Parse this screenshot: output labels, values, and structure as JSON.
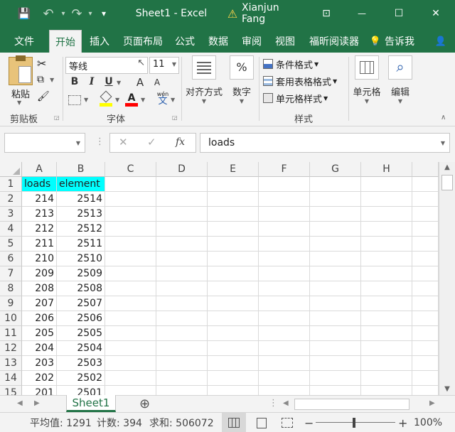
{
  "window": {
    "title": "Sheet1  -  Excel",
    "user": "Xianjun Fang",
    "save_icon": "💾",
    "undo_icon": "↶",
    "redo_icon": "↷",
    "qat_icon": "▾",
    "warning_icon": "⚠",
    "restore_ribbon_icon": "⊡",
    "minimize_icon": "—",
    "maximize_icon": "☐",
    "close_icon": "✕"
  },
  "menu": {
    "tabs": [
      {
        "label": "文件"
      },
      {
        "label": "开始"
      },
      {
        "label": "插入"
      },
      {
        "label": "页面布局"
      },
      {
        "label": "公式"
      },
      {
        "label": "数据"
      },
      {
        "label": "审阅"
      },
      {
        "label": "视图"
      },
      {
        "label": "福昕阅读器"
      }
    ],
    "tell_me": "告诉我",
    "lightbulb_icon": "💡",
    "share_icon": "👤"
  },
  "ribbon": {
    "clipboard": {
      "label": "剪贴板",
      "paste": "粘贴",
      "cut_icon": "✂",
      "copy_icon": "⧉",
      "format_painter_icon": "🖌"
    },
    "font": {
      "label": "字体",
      "font_name": "等线",
      "font_size": "11",
      "bold": "B",
      "italic": "I",
      "underline": "U",
      "grow_font": "A",
      "shrink_font": "A",
      "font_color_letter": "A",
      "phonetic": "wén",
      "phonetic_char": "文",
      "fill_color": "#ffff00",
      "font_color": "#ff0000"
    },
    "alignment": {
      "label": "对齐方式"
    },
    "number": {
      "label": "数字",
      "icon": "%"
    },
    "styles": {
      "label": "样式",
      "conditional": "条件格式",
      "table_format": "套用表格格式",
      "cell_styles": "单元格样式"
    },
    "cells": {
      "label": "单元格"
    },
    "editing": {
      "label": "编辑",
      "icon": "⌕"
    }
  },
  "formula_bar": {
    "name_box": "",
    "cancel_icon": "✕",
    "enter_icon": "✓",
    "fx_label": "fx",
    "content": "loads"
  },
  "sheet": {
    "columns": [
      "A",
      "B",
      "C",
      "D",
      "E",
      "F",
      "G",
      "H"
    ],
    "rows": [
      {
        "n": "1",
        "a": "loads",
        "b": "element"
      },
      {
        "n": "2",
        "a": "214",
        "b": "2514"
      },
      {
        "n": "3",
        "a": "213",
        "b": "2513"
      },
      {
        "n": "4",
        "a": "212",
        "b": "2512"
      },
      {
        "n": "5",
        "a": "211",
        "b": "2511"
      },
      {
        "n": "6",
        "a": "210",
        "b": "2510"
      },
      {
        "n": "7",
        "a": "209",
        "b": "2509"
      },
      {
        "n": "8",
        "a": "208",
        "b": "2508"
      },
      {
        "n": "9",
        "a": "207",
        "b": "2507"
      },
      {
        "n": "10",
        "a": "206",
        "b": "2506"
      },
      {
        "n": "11",
        "a": "205",
        "b": "2505"
      },
      {
        "n": "12",
        "a": "204",
        "b": "2504"
      },
      {
        "n": "13",
        "a": "203",
        "b": "2503"
      },
      {
        "n": "14",
        "a": "202",
        "b": "2502"
      },
      {
        "n": "15",
        "a": "201",
        "b": "2501"
      }
    ],
    "highlight_color": "#00ffff"
  },
  "sheet_tabs": {
    "active": "Sheet1",
    "add_icon": "⊕"
  },
  "status": {
    "average": "平均值: 1291",
    "count": "计数: 394",
    "sum": "求和: 506072",
    "zoom": "100%",
    "zoom_minus": "−",
    "zoom_plus": "+"
  },
  "colors": {
    "accent": "#217346",
    "ribbon_bg": "#f3f3f3"
  }
}
